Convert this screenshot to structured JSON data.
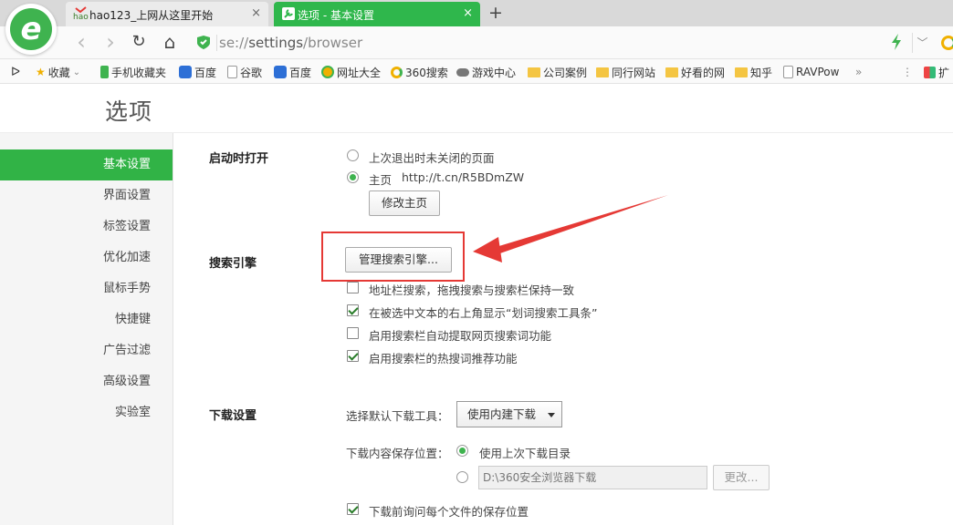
{
  "tabs": [
    {
      "favicon_text": "hao",
      "title": "hao123_上网从这里开始",
      "close": "×"
    },
    {
      "title": "选项 - 基本设置",
      "close": "×"
    }
  ],
  "new_tab": "+",
  "nav": {
    "back": "‹",
    "forward": "›",
    "reload": "↻",
    "home": "⌂",
    "dropdown": "﹀"
  },
  "address": {
    "scheme": "se://",
    "path": "settings",
    "rest": "/browser"
  },
  "bookmarks": [
    {
      "label": "收藏",
      "icon": "star-icon"
    },
    {
      "label": "手机收藏夹",
      "icon": "phone-icon"
    },
    {
      "label": "百度",
      "icon": "baidu-paw-icon"
    },
    {
      "label": "谷歌",
      "icon": "page-icon"
    },
    {
      "label": "百度",
      "icon": "baidu-paw-icon"
    },
    {
      "label": "网址大全",
      "icon": "wangzhi-icon"
    },
    {
      "label": "360搜索",
      "icon": "360-icon"
    },
    {
      "label": "游戏中心",
      "icon": "gamepad-icon"
    },
    {
      "label": "公司案例",
      "icon": "folder-icon"
    },
    {
      "label": "同行网站",
      "icon": "folder-icon"
    },
    {
      "label": "好看的网",
      "icon": "folder-icon"
    },
    {
      "label": "知乎",
      "icon": "folder-icon"
    },
    {
      "label": "RAVPow",
      "icon": "page-icon"
    }
  ],
  "bookmarks_more": "»",
  "bookmarks_extra": "扩",
  "page_title": "选项",
  "sidebar": [
    {
      "label": "基本设置",
      "active": true
    },
    {
      "label": "界面设置"
    },
    {
      "label": "标签设置"
    },
    {
      "label": "优化加速"
    },
    {
      "label": "鼠标手势"
    },
    {
      "label": "快捷键"
    },
    {
      "label": "广告过滤"
    },
    {
      "label": "高级设置"
    },
    {
      "label": "实验室"
    }
  ],
  "startup": {
    "label": "启动时打开",
    "opt_restore": "上次退出时未关闭的页面",
    "opt_home": "主页",
    "home_url": "http://t.cn/R5BDmZW",
    "change_home": "修改主页"
  },
  "search": {
    "label": "搜索引擎",
    "manage": "管理搜索引擎...",
    "options": [
      {
        "label": "地址栏搜索，拖拽搜索与搜索栏保持一致",
        "checked": false
      },
      {
        "label": "在被选中文本的右上角显示“划词搜索工具条”",
        "checked": true
      },
      {
        "label": "启用搜索栏自动提取网页搜索词功能",
        "checked": false
      },
      {
        "label": "启用搜索栏的热搜词推荐功能",
        "checked": true
      }
    ]
  },
  "download": {
    "label": "下载设置",
    "tool_label": "选择默认下载工具：",
    "tool_value": "使用内建下载",
    "location_label": "下载内容保存位置：",
    "opt_last_dir": "使用上次下载目录",
    "path": "D:\\360安全浏览器下载",
    "change": "更改...",
    "ask_each": "下载前询问每个文件的保存位置"
  },
  "colors": {
    "accent": "#31b346",
    "annotation": "#e53935"
  }
}
